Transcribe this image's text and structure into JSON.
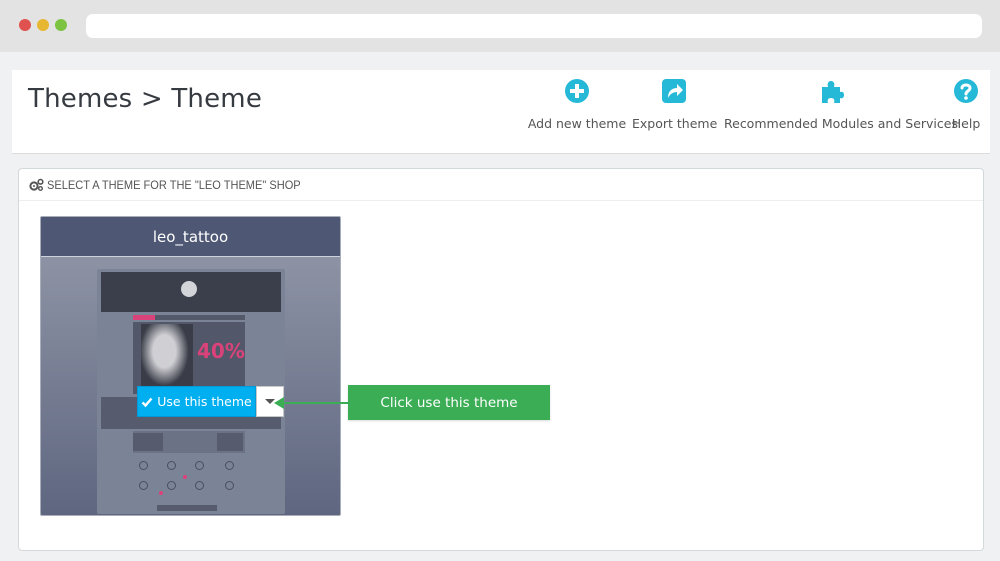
{
  "page": {
    "title": "Themes > Theme"
  },
  "toolbar": {
    "add_new_theme": "Add new theme",
    "export_theme": "Export theme",
    "recommended_modules": "Recommended Modules and Services",
    "help": "Help"
  },
  "panel": {
    "heading": "SELECT A THEME FOR THE \"LEO THEME\" SHOP"
  },
  "theme_card": {
    "name": "leo_tattoo",
    "preview_sale_text": "40%",
    "use_button_label": "Use this theme"
  },
  "annotation": {
    "callout_text": "Click use this theme"
  },
  "colors": {
    "accent_blue": "#00aff0",
    "toolbar_icon": "#25b9d7",
    "card_header": "#4e5874",
    "callout_green": "#3aad55",
    "preview_pink": "#d9437a"
  },
  "icons": {
    "add": "plus-circle-icon",
    "export": "share-icon",
    "modules": "puzzle-icon",
    "help": "question-circle-icon",
    "heading": "cogs-icon",
    "use": "check-icon",
    "dropdown": "caret-down-icon"
  }
}
